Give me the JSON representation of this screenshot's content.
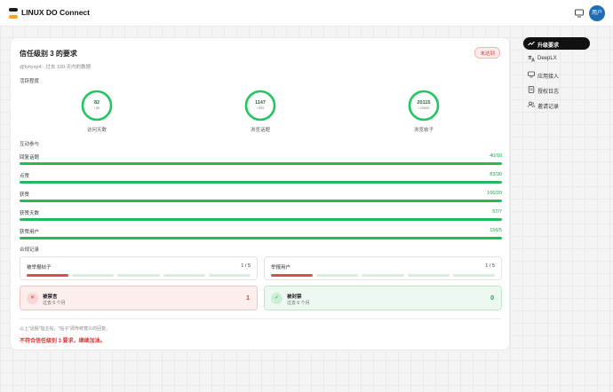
{
  "app": {
    "brand": "LINUX DO Connect",
    "avatar_text": "用户"
  },
  "card": {
    "title": "信任级别 3 的要求",
    "status_badge": "未达到",
    "subtitle": "@fyhyxp4 - 过去 100 天内的数据"
  },
  "activity": {
    "section_label": "活跃程度",
    "metrics": [
      {
        "value": "82",
        "target": "/ 50",
        "label": "访问天数"
      },
      {
        "value": "1147",
        "target": "/ 500",
        "label": "浏览话题"
      },
      {
        "value": "20115",
        "target": "/ 20000",
        "label": "浏览帖子"
      }
    ]
  },
  "interaction": {
    "section_label": "互动参与",
    "bars": [
      {
        "label": "回复话题",
        "value": "40/10",
        "progress": 1.0
      },
      {
        "label": "点赞",
        "value": "83/30",
        "progress": 1.0
      },
      {
        "label": "获赞",
        "value": "166/20",
        "progress": 1.0
      },
      {
        "label": "获赞天数",
        "value": "57/7",
        "progress": 1.0
      },
      {
        "label": "获赞用户",
        "value": "156/5",
        "progress": 1.0
      }
    ]
  },
  "compliance": {
    "section_label": "合规记录",
    "flagged_posts": {
      "title": "被举报帖子",
      "count": "1 / 5",
      "filled": 1,
      "total": 5
    },
    "flagged_users": {
      "title": "举报用户",
      "count": "1 / 5",
      "filled": 1,
      "total": 5
    },
    "silenced": {
      "title": "被禁言",
      "sub": "过去 6 个月",
      "count": "1"
    },
    "suspended": {
      "title": "被封禁",
      "sub": "过去 6 个月",
      "count": "0"
    }
  },
  "footer": {
    "note": "以上\"话题\"指主帖，\"帖子\"即传统意义的回复。",
    "verdict": "不符合信任级别 3 要求，继续加油。"
  },
  "sidebar": {
    "items": [
      {
        "label": "升级要求",
        "icon": "trending-up-icon",
        "active": true
      },
      {
        "label": "DeepLX",
        "icon": "translate-icon",
        "active": false
      },
      {
        "label": "应用接入",
        "icon": "apps-icon",
        "active": false
      },
      {
        "label": "授权日志",
        "icon": "log-icon",
        "active": false
      },
      {
        "label": "邀请记录",
        "icon": "users-icon",
        "active": false
      }
    ]
  },
  "colors": {
    "success": "#27b85d",
    "danger": "#e5484d",
    "ring": "#22c55e"
  }
}
